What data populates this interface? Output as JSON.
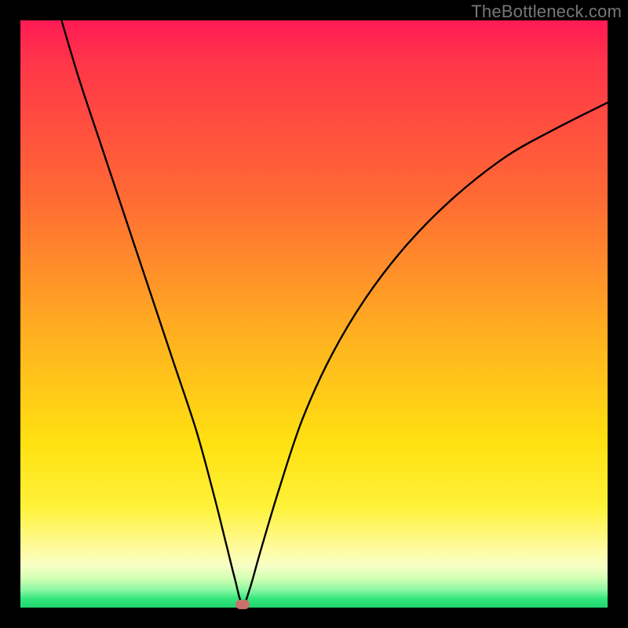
{
  "watermark": "TheBottleneck.com",
  "marker": {
    "x_pct": 37.8,
    "y_pct": 99.5
  },
  "chart_data": {
    "type": "line",
    "title": "",
    "xlabel": "",
    "ylabel": "",
    "xlim": [
      0,
      100
    ],
    "ylim": [
      0,
      100
    ],
    "series": [
      {
        "name": "bottleneck-curve",
        "x": [
          7,
          10,
          14,
          18,
          22,
          26,
          30,
          33,
          35,
          36.5,
          37.8,
          39,
          41,
          44,
          48,
          53,
          59,
          66,
          74,
          83,
          92,
          100
        ],
        "y": [
          100,
          90,
          78,
          66,
          54,
          42,
          30,
          19,
          11,
          5,
          0.5,
          3,
          10,
          20,
          32,
          43,
          53,
          62,
          70,
          77,
          82,
          86
        ]
      }
    ],
    "marker_point": {
      "x": 37.8,
      "y": 0.5
    },
    "gradient_stops": [
      {
        "pct": 0,
        "color": "#ff1a55"
      },
      {
        "pct": 30,
        "color": "#ff6a34"
      },
      {
        "pct": 55,
        "color": "#ffb41f"
      },
      {
        "pct": 83,
        "color": "#fff23a"
      },
      {
        "pct": 93,
        "color": "#f6ffc6"
      },
      {
        "pct": 100,
        "color": "#20d66f"
      }
    ]
  }
}
